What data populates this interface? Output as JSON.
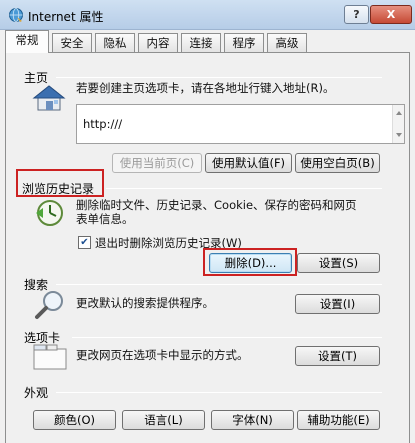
{
  "window": {
    "title": "Internet 属性",
    "help_label": "?",
    "close_label": "X"
  },
  "tabs": [
    {
      "label": "常规",
      "active": true
    },
    {
      "label": "安全"
    },
    {
      "label": "隐私"
    },
    {
      "label": "内容"
    },
    {
      "label": "连接"
    },
    {
      "label": "程序"
    },
    {
      "label": "高级"
    }
  ],
  "home": {
    "heading": "主页",
    "description": "若要创建主页选项卡，请在各地址行键入地址(R)。",
    "url_value": "http:///",
    "buttons": {
      "use_current": "使用当前页(C)",
      "use_default": "使用默认值(F)",
      "use_blank": "使用空白页(B)"
    }
  },
  "history": {
    "heading": "浏览历史记录",
    "description_line1": "删除临时文件、历史记录、Cookie、保存的密码和网页",
    "description_line2": "表单信息。",
    "checkbox_label": "退出时删除浏览历史记录(W)",
    "checkbox_checked": true,
    "checkmark": "✔",
    "buttons": {
      "delete": "删除(D)...",
      "settings": "设置(S)"
    }
  },
  "search": {
    "heading": "搜索",
    "description": "更改默认的搜索提供程序。",
    "settings_button": "设置(I)"
  },
  "tabs_group": {
    "heading": "选项卡",
    "description": "更改网页在选项卡中显示的方式。",
    "settings_button": "设置(T)"
  },
  "appearance": {
    "heading": "外观",
    "buttons": {
      "colors": "颜色(O)",
      "languages": "语言(L)",
      "fonts": "字体(N)",
      "accessibility": "辅助功能(E)"
    }
  }
}
